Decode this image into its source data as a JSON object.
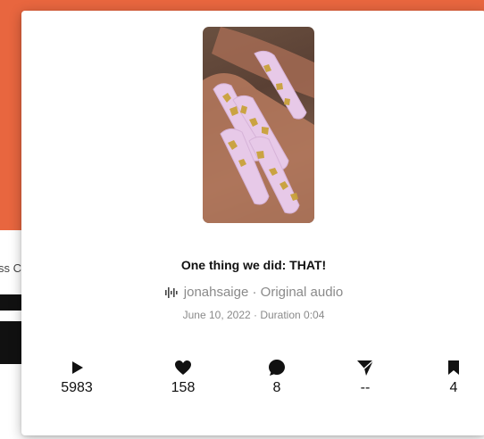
{
  "background": {
    "accent_color": "#e8663f",
    "partial_text": "ss C"
  },
  "post": {
    "title": "One thing we did: THAT!",
    "audio": {
      "icon": "audio-waveform-icon",
      "author": "jonahsaige",
      "separator": "·",
      "label": "Original audio",
      "text": "jonahsaige · Original audio"
    },
    "meta": "June 10, 2022 · Duration 0:04",
    "thumbnail": {
      "icon": "nails-photo",
      "description_colors": {
        "nail": "#e7c9e8",
        "gold": "#c9a23a",
        "skin": "#b77a5e"
      }
    }
  },
  "stats": [
    {
      "name": "plays",
      "icon": "play-icon",
      "value": "5983"
    },
    {
      "name": "likes",
      "icon": "heart-icon",
      "value": "158"
    },
    {
      "name": "comments",
      "icon": "comment-icon",
      "value": "8"
    },
    {
      "name": "shares",
      "icon": "send-icon",
      "value": "--"
    },
    {
      "name": "saves",
      "icon": "bookmark-icon",
      "value": "4"
    }
  ]
}
